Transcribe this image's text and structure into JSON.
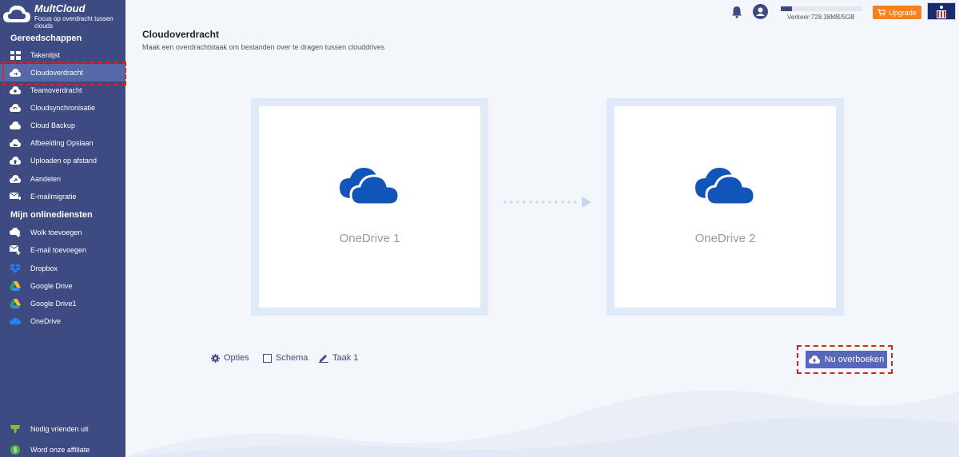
{
  "brand": {
    "name": "MultCloud",
    "tagline": "Focus op overdracht tussen clouds"
  },
  "sidebar": {
    "tools_title": "Gereedschappen",
    "tools": [
      {
        "label": "Takenlijst",
        "icon": "task-list-icon"
      },
      {
        "label": "Cloudoverdracht",
        "icon": "cloud-transfer-icon"
      },
      {
        "label": "Teamoverdracht",
        "icon": "team-transfer-icon"
      },
      {
        "label": "Cloudsynchronisatie",
        "icon": "cloud-sync-icon"
      },
      {
        "label": "Cloud Backup",
        "icon": "cloud-backup-icon"
      },
      {
        "label": "Afbeelding Opslaan",
        "icon": "image-save-icon"
      },
      {
        "label": "Uploaden op afstand",
        "icon": "remote-upload-icon"
      },
      {
        "label": "Aandelen",
        "icon": "share-icon"
      },
      {
        "label": "E-mailmigratie",
        "icon": "email-migration-icon"
      }
    ],
    "services_title": "Mijn onlinediensten",
    "services": [
      {
        "label": "Wolk toevoegen",
        "icon": "add-cloud-icon"
      },
      {
        "label": "E-mail toevoegen",
        "icon": "add-email-icon"
      },
      {
        "label": "Dropbox",
        "icon": "dropbox-icon"
      },
      {
        "label": "Google Drive",
        "icon": "google-drive-icon"
      },
      {
        "label": "Google Drive1",
        "icon": "google-drive-icon"
      },
      {
        "label": "OneDrive",
        "icon": "onedrive-icon"
      }
    ],
    "footer": [
      {
        "label": "Nodig vrienden uit",
        "icon": "invite-icon"
      },
      {
        "label": "Word onze affiliate",
        "icon": "affiliate-icon"
      }
    ]
  },
  "topbar": {
    "traffic_text": "Verkeer:728.38MB/5GB",
    "traffic_used_fraction": 0.14,
    "upgrade_label": "Upgrade"
  },
  "main": {
    "title": "Cloudoverdracht",
    "subtitle": "Maak een overdrachtstaak om bestanden over te dragen tussen clouddrives",
    "source_label": "OneDrive 1",
    "target_label": "OneDrive 2",
    "options_label": "Opties",
    "schedule_label": "Schema",
    "task_label": "Taak 1",
    "transfer_button_label": "Nu overboeken"
  },
  "colors": {
    "sidebar": "#3d4b82",
    "accent": "#5868b8",
    "upgrade": "#f5821f",
    "onedrive": "#1155b8",
    "highlight": "#e02020"
  }
}
